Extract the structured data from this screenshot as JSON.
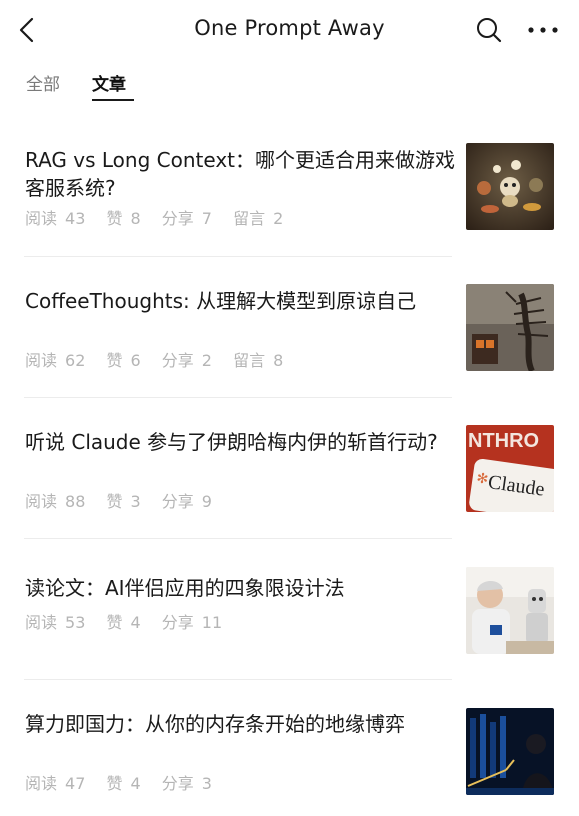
{
  "header": {
    "title": "One Prompt Away"
  },
  "tabs": [
    {
      "label": "全部",
      "active": false
    },
    {
      "label": "文章",
      "active": true
    }
  ],
  "articles": [
    {
      "title": "RAG vs Long Context：哪个更适合用来做游戏客服系统?",
      "read_label": "阅读",
      "read": "43",
      "like_label": "赞",
      "like": "8",
      "share_label": "分享",
      "share": "7",
      "comment_label": "留言",
      "comment": "2",
      "thumb_icon": "cartoon-characters-thumbnail"
    },
    {
      "title": "CoffeeThoughts: 从理解大模型到原谅自己",
      "read_label": "阅读",
      "read": "62",
      "like_label": "赞",
      "like": "6",
      "share_label": "分享",
      "share": "2",
      "comment_label": "留言",
      "comment": "8",
      "thumb_icon": "skeleton-painting-thumbnail"
    },
    {
      "title": "听说 Claude 参与了伊朗哈梅内伊的斩首行动?",
      "read_label": "阅读",
      "read": "88",
      "like_label": "赞",
      "like": "3",
      "share_label": "分享",
      "share": "9",
      "thumb_icon": "claude-logo-thumbnail",
      "thumb_text_top": "NTHRO",
      "thumb_text_main": "Claude"
    },
    {
      "title": "读论文：AI伴侣应用的四象限设计法",
      "read_label": "阅读",
      "read": "53",
      "like_label": "赞",
      "like": "4",
      "share_label": "分享",
      "share": "11",
      "thumb_icon": "elderly-man-robot-thumbnail"
    },
    {
      "title": "算力即国力：从你的内存条开始的地缘博弈",
      "read_label": "阅读",
      "read": "47",
      "like_label": "赞",
      "like": "4",
      "share_label": "分享",
      "share": "3",
      "thumb_icon": "server-chart-thumbnail"
    }
  ],
  "colors": {
    "text": "#1a1a1a",
    "muted": "#b5b5b5",
    "tab_inactive": "#7a7a7a",
    "divider": "#ececec"
  }
}
